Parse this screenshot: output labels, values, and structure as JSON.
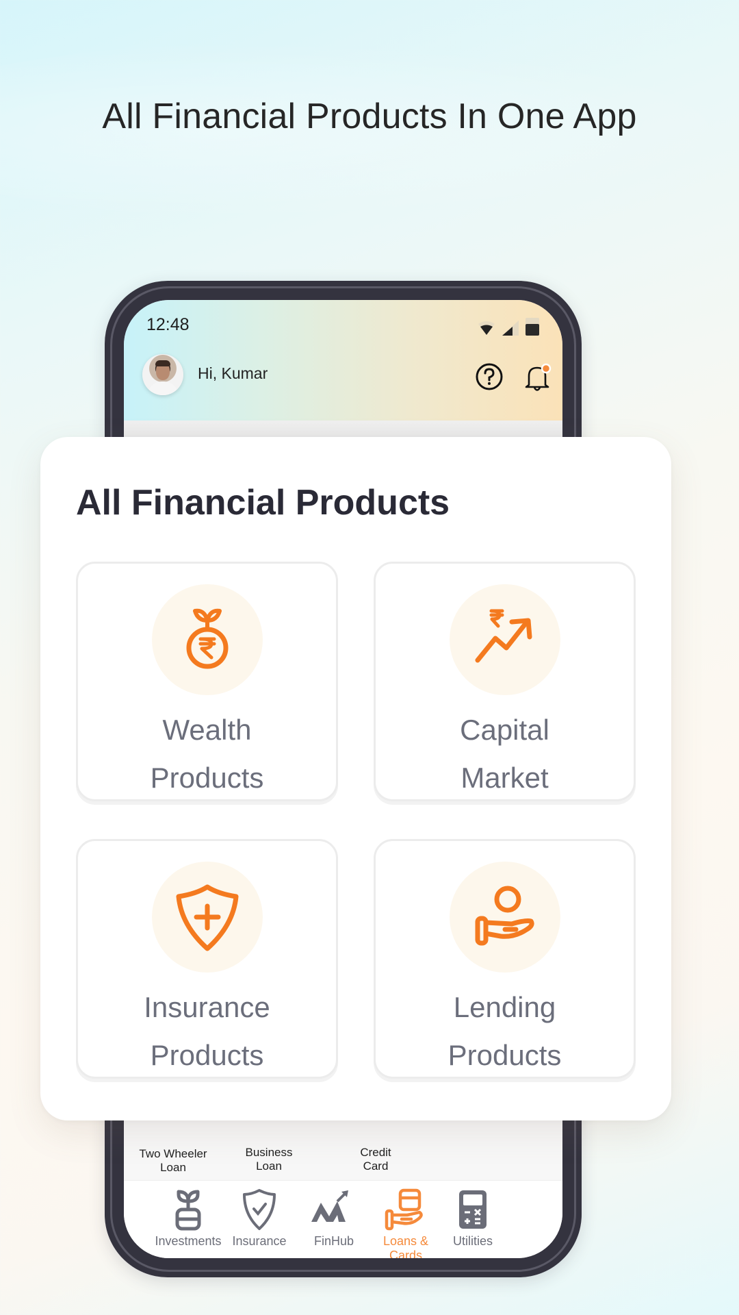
{
  "headline": "All Financial Products In One App",
  "colors": {
    "accent": "#F47A1F",
    "text_dark": "#2A2A36",
    "tile_label": "#6B6E7B",
    "nav_inactive": "#6B6D78",
    "nav_active": "#F58A3B",
    "phone_frame": "#34333F"
  },
  "phone": {
    "status_bar": {
      "time": "12:48",
      "icons": [
        "wifi-icon",
        "signal-icon",
        "battery-icon"
      ]
    },
    "header": {
      "greeting": "Hi, Kumar",
      "icons": [
        "help-icon",
        "notification-bell-icon"
      ],
      "notification_dot": true
    },
    "peek_items": [
      {
        "label_line1": "Two Wheeler",
        "label_line2": "Loan"
      },
      {
        "label_line1": "Business",
        "label_line2": "Loan"
      },
      {
        "label_line1": "Credit",
        "label_line2": "Card"
      }
    ],
    "bottom_nav": [
      {
        "label": "Investments",
        "icon": "plant-coin-icon",
        "active": false
      },
      {
        "label": "Insurance",
        "icon": "shield-check-icon",
        "active": false
      },
      {
        "label": "FinHub",
        "icon": "finhub-logo-icon",
        "active": false
      },
      {
        "label": "Loans & Cards",
        "icon": "hand-card-icon",
        "active": true
      },
      {
        "label": "Utilities",
        "icon": "calculator-icon",
        "active": false
      }
    ]
  },
  "overlay": {
    "title": "All Financial Products",
    "tiles": [
      {
        "line1": "Wealth",
        "line2": "Products",
        "icon": "money-plant-rupee-icon"
      },
      {
        "line1": "Capital",
        "line2": "Market",
        "icon": "rupee-trend-up-icon"
      },
      {
        "line1": "Insurance",
        "line2": "Products",
        "icon": "shield-plus-icon"
      },
      {
        "line1": "Lending",
        "line2": "Products",
        "icon": "hand-coin-icon"
      }
    ]
  }
}
